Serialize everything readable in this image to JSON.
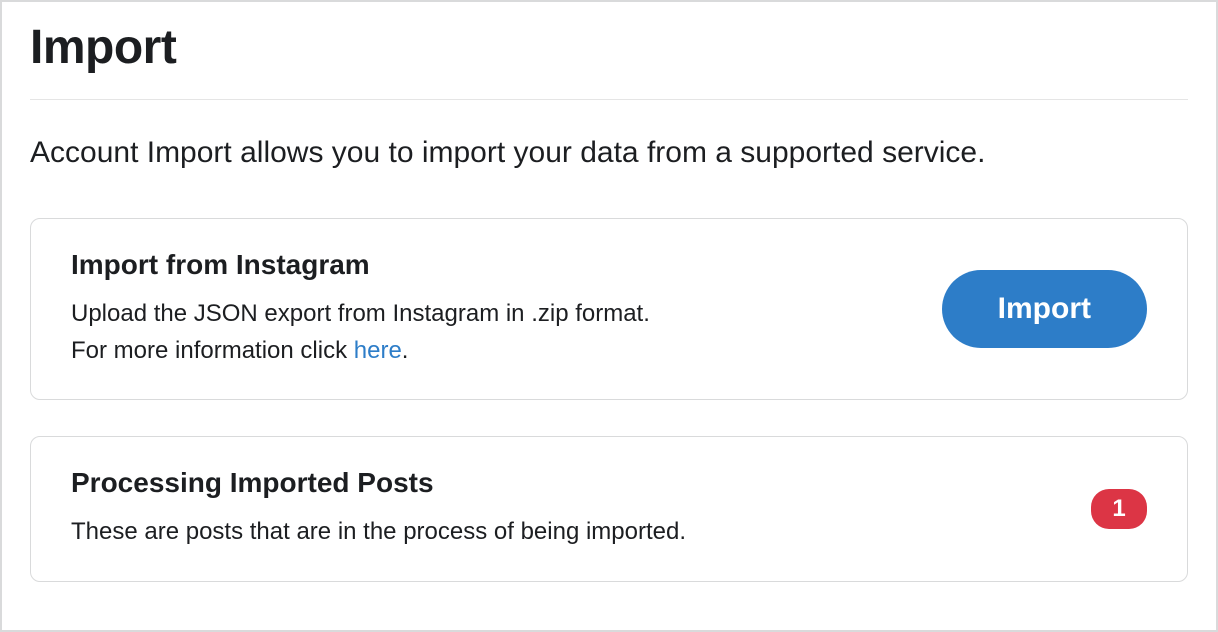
{
  "page": {
    "title": "Import",
    "intro": "Account Import allows you to import your data from a supported service."
  },
  "importCard": {
    "title": "Import from Instagram",
    "descLine1": "Upload the JSON export from Instagram in .zip format.",
    "descLine2Prefix": "For more information click ",
    "linkText": "here",
    "descLine2Suffix": ".",
    "buttonLabel": "Import"
  },
  "processingCard": {
    "title": "Processing Imported Posts",
    "desc": "These are posts that are in the process of being imported.",
    "badgeCount": "1"
  }
}
